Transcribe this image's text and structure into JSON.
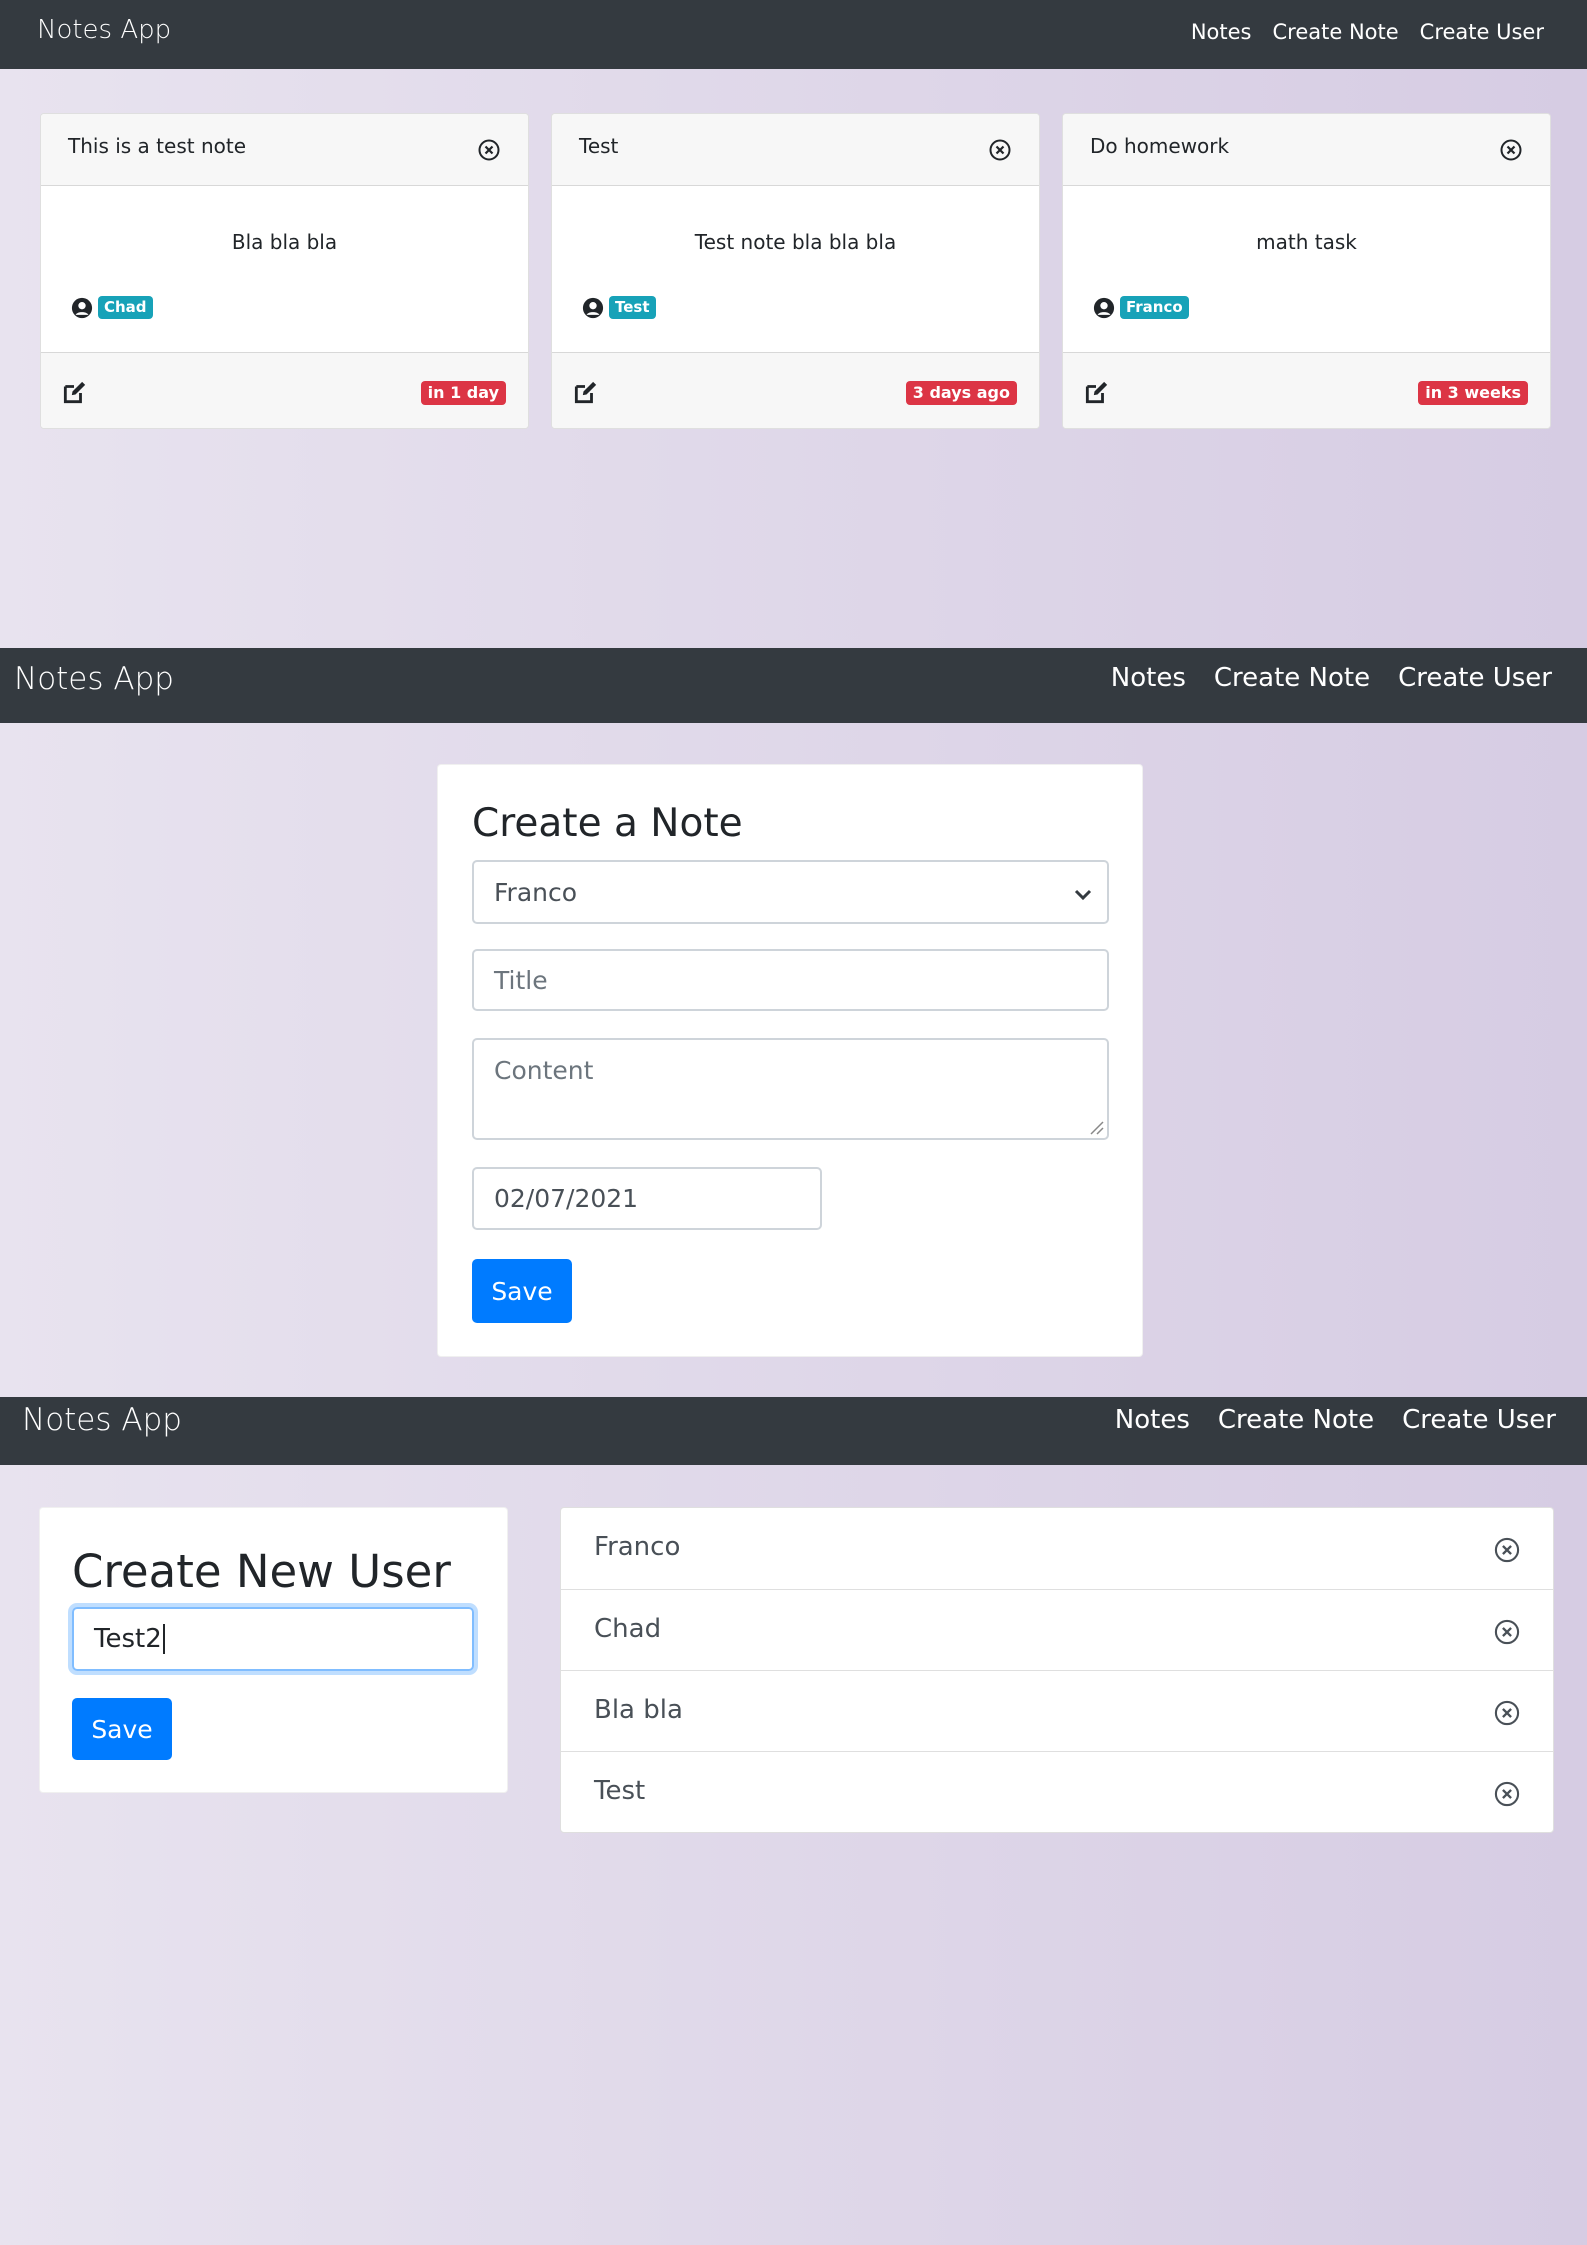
{
  "navbar": {
    "brand": "Notes App",
    "links": [
      "Notes",
      "Create Note",
      "Create User"
    ]
  },
  "notes": [
    {
      "title": "This is a test note",
      "content": "Bla bla bla",
      "author": "Chad",
      "date": "in 1 day"
    },
    {
      "title": "Test",
      "content": "Test note bla bla bla",
      "author": "Test",
      "date": "3 days ago"
    },
    {
      "title": "Do homework",
      "content": "math task",
      "author": "Franco",
      "date": "in 3 weeks"
    }
  ],
  "create_note": {
    "heading": "Create a Note",
    "selected_user": "Franco",
    "title_placeholder": "Title",
    "content_placeholder": "Content",
    "date_value": "02/07/2021",
    "save_label": "Save"
  },
  "create_user": {
    "heading": "Create New User",
    "username_value": "Test2",
    "save_label": "Save"
  },
  "users": [
    "Franco",
    "Chad",
    "Bla bla",
    "Test"
  ],
  "icons": {
    "close": "circle-x-icon",
    "user": "user-circle-icon",
    "edit": "edit-icon",
    "select": "chevron-down-icon"
  },
  "colors": {
    "navbar": "#343a40",
    "primary": "#007bff",
    "info": "#17a2b8",
    "danger": "#dc3545"
  }
}
